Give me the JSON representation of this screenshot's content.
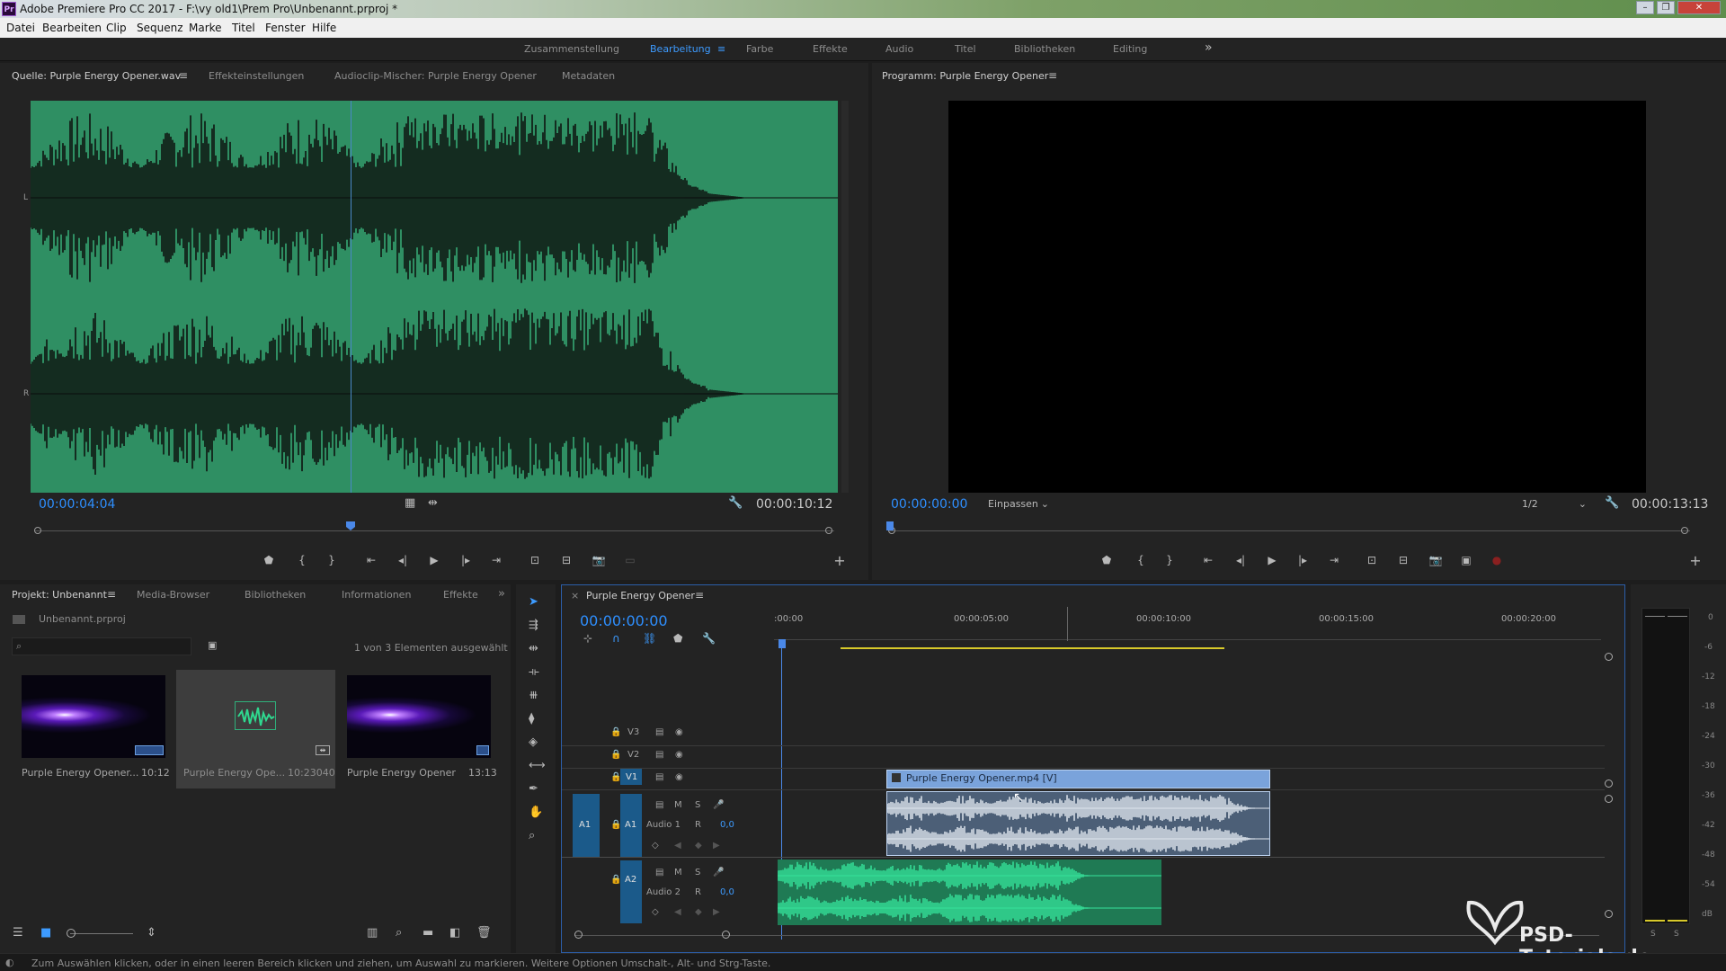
{
  "window": {
    "title": "Adobe Premiere Pro CC 2017 - F:\\vy old1\\Prem Pro\\Unbenannt.prproj *",
    "app_badge": "Pr",
    "buttons": [
      "–",
      "❐",
      "✕"
    ]
  },
  "menu": [
    "Datei",
    "Bearbeiten",
    "Clip",
    "Sequenz",
    "Marke",
    "Titel",
    "Fenster",
    "Hilfe"
  ],
  "workspaces": {
    "items": [
      "Zusammenstellung",
      "Bearbeitung",
      "Farbe",
      "Effekte",
      "Audio",
      "Titel",
      "Bibliotheken",
      "Editing"
    ],
    "active": "Bearbeitung",
    "more": "»"
  },
  "source_panel": {
    "tabs": [
      "Quelle: Purple Energy Opener.wav",
      "Effekteinstellungen",
      "Audioclip-Mischer: Purple Energy Opener",
      "Metadaten"
    ],
    "timecode_current": "00:00:04:04",
    "timecode_duration": "00:00:10:12",
    "channel_L": "L",
    "channel_R": "R",
    "waveform_color": "#2f8f63"
  },
  "program_panel": {
    "tab": "Programm: Purple Energy Opener",
    "timecode_current": "00:00:00:00",
    "fit": "Einpassen",
    "resolution": "1/2",
    "timecode_duration": "00:00:13:13"
  },
  "project_panel": {
    "tabs": [
      "Projekt: Unbenannt",
      "Media-Browser",
      "Bibliotheken",
      "Informationen",
      "Effekte"
    ],
    "file": "Unbenannt.prproj",
    "selection_info": "1 von 3 Elementen ausgewählt",
    "items": [
      {
        "name": "Purple Energy Opener...",
        "duration": "10:12"
      },
      {
        "name": "Purple Energy Ope...",
        "duration": "10:23040"
      },
      {
        "name": "Purple Energy Opener",
        "duration": "13:13"
      }
    ]
  },
  "timeline": {
    "tab": "Purple Energy Opener",
    "close": "×",
    "timecode": "00:00:00:00",
    "ruler": [
      ":00:00",
      "00:00:05:00",
      "00:00:10:00",
      "00:00:15:00",
      "00:00:20:00"
    ],
    "video_tracks": [
      "V3",
      "V2",
      "V1"
    ],
    "audio_tracks": [
      {
        "src": "A1",
        "id": "A1",
        "name": "Audio 1",
        "m": "M",
        "s": "S",
        "r": "R",
        "vol": "0,0"
      },
      {
        "src": "",
        "id": "A2",
        "name": "Audio 2",
        "m": "M",
        "s": "S",
        "r": "R",
        "vol": "0,0"
      }
    ],
    "video_clip": "Purple Energy Opener.mp4 [V]"
  },
  "meter": {
    "labels": [
      "0",
      "-6",
      "-12",
      "-18",
      "-24",
      "-30",
      "-36",
      "-42",
      "-48",
      "-54",
      "dB"
    ],
    "bottom": [
      "S",
      "S"
    ]
  },
  "watermark": "PSD-Tutorials.de",
  "status_bar": "Zum Auswählen klicken, oder in einen leeren Bereich klicken und ziehen, um Auswahl zu markieren. Weitere Optionen Umschalt-, Alt- und Strg-Taste."
}
